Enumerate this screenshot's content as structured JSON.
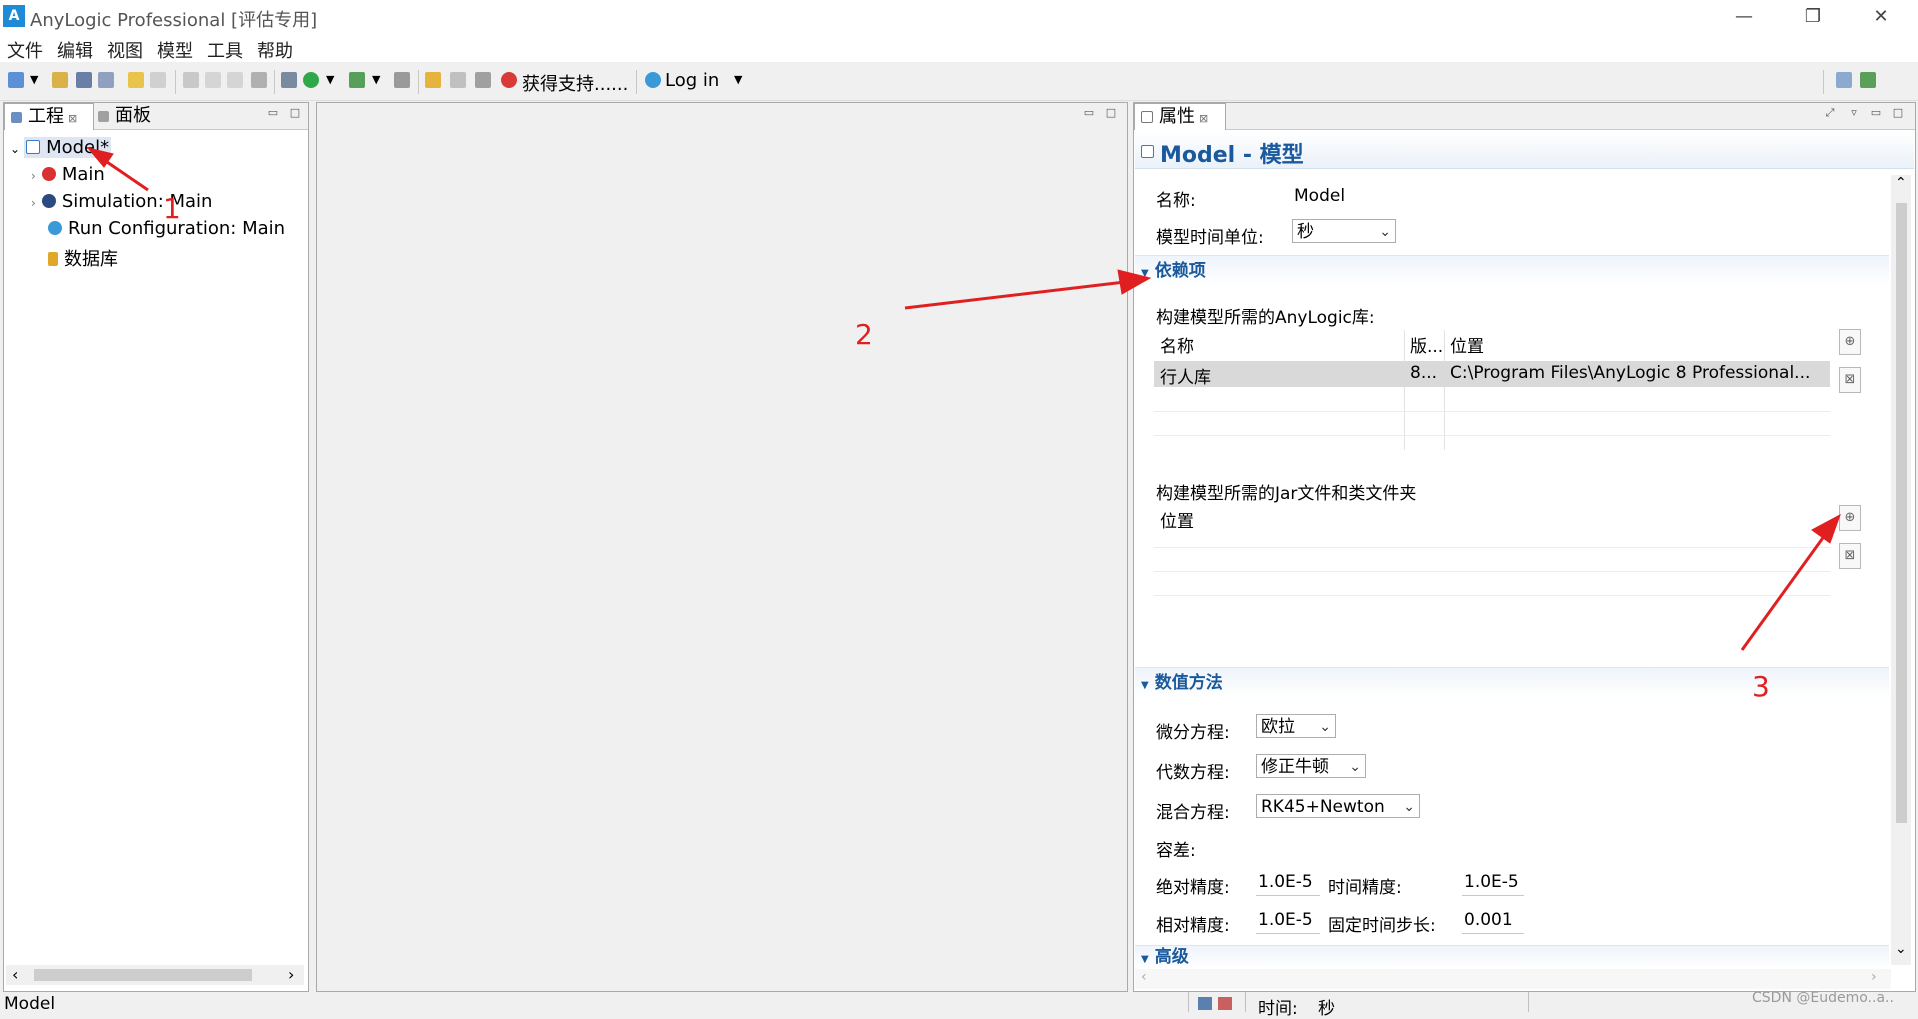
{
  "window": {
    "title": "AnyLogic Professional [评估专用]",
    "logo_text": "A",
    "controls": {
      "minimize": "—",
      "restore": "❐",
      "close": "✕"
    }
  },
  "menu": [
    "文件",
    "编辑",
    "视图",
    "模型",
    "工具",
    "帮助"
  ],
  "toolbar": {
    "support_label": "获得支持......",
    "login_label": "Log in"
  },
  "left_panel": {
    "tabs": [
      {
        "label": "工程"
      },
      {
        "label": "面板"
      }
    ],
    "tree": [
      {
        "label": "Model*",
        "icon": "model-icon"
      },
      {
        "label": "Main",
        "icon": "agent-icon"
      },
      {
        "label": "Simulation: Main",
        "icon": "simulation-icon"
      },
      {
        "label": "Run Configuration: Main",
        "icon": "run-config-icon"
      },
      {
        "label": "数据库",
        "icon": "database-icon"
      }
    ]
  },
  "properties": {
    "tab_label": "属性",
    "header": "Model - 模型",
    "name_label": "名称:",
    "name_value": "Model",
    "time_unit_label": "模型时间单位:",
    "time_unit_value": "秒",
    "dependencies": {
      "section_title": "依赖项",
      "libs_caption": "构建模型所需的AnyLogic库:",
      "columns": [
        "名称",
        "版...",
        "位置"
      ],
      "rows": [
        {
          "name": "行人库",
          "version": "8...",
          "location": "C:\\Program Files\\AnyLogic 8 Professional..."
        }
      ],
      "jar_caption": "构建模型所需的Jar文件和类文件夹",
      "jar_column": "位置"
    },
    "numerical": {
      "section_title": "数值方法",
      "diff_label": "微分方程:",
      "diff_value": "欧拉",
      "alg_label": "代数方程:",
      "alg_value": "修正牛顿",
      "mixed_label": "混合方程:",
      "mixed_value": "RK45+Newton",
      "tolerance_label": "容差:",
      "abs_label": "绝对精度:",
      "abs_value": "1.0E-5",
      "time_acc_label": "时间精度:",
      "time_acc_value": "1.0E-5",
      "rel_label": "相对精度:",
      "rel_value": "1.0E-5",
      "fixed_step_label": "固定时间步长:",
      "fixed_step_value": "0.001"
    },
    "advanced": {
      "section_title": "高级"
    }
  },
  "status": {
    "left": "Model",
    "time_label": "时间:",
    "time_unit": "秒",
    "watermark": "CSDN @Eudemo..a.."
  },
  "annotations": [
    "1",
    "2",
    "3"
  ],
  "colors": {
    "accent": "#1a5a9c",
    "annotation": "#e02020"
  }
}
